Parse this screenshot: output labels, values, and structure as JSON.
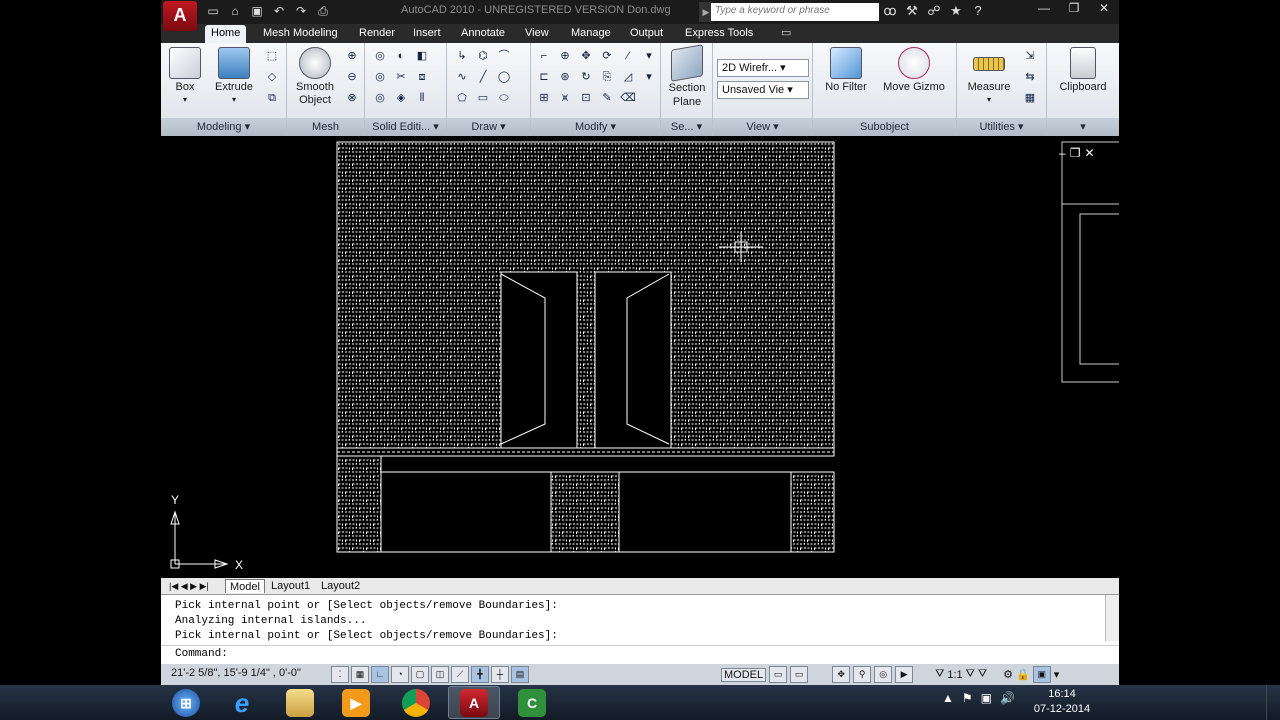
{
  "app": {
    "title": "AutoCAD 2010 - UNREGISTERED VERSION     Don.dwg",
    "search_placeholder": "Type a keyword or phrase",
    "logo_letter": "A"
  },
  "qat": [
    "new-icon",
    "open-icon",
    "save-icon",
    "undo-icon",
    "redo-icon",
    "plot-icon"
  ],
  "tabs": [
    "Home",
    "Mesh Modeling",
    "Render",
    "Insert",
    "Annotate",
    "View",
    "Manage",
    "Output",
    "Express Tools"
  ],
  "ribbon": {
    "modeling": {
      "title": "Modeling",
      "box": "Box",
      "extrude": "Extrude",
      "smooth": "Smooth Object"
    },
    "mesh": {
      "title": "Mesh"
    },
    "solid": {
      "title": "Solid Editi..."
    },
    "draw": {
      "title": "Draw"
    },
    "modify": {
      "title": "Modify"
    },
    "section": {
      "title": "Se...",
      "label": "Section Plane"
    },
    "view": {
      "title": "View",
      "visual_style": "2D Wirefr...",
      "saved_view": "Unsaved Vie"
    },
    "subobject": {
      "title": "Subobject",
      "no_filter": "No Filter",
      "move_gizmo": "Move Gizmo"
    },
    "utilities": {
      "title": "Utilities",
      "measure": "Measure"
    },
    "clipboard": {
      "label": "Clipboard"
    }
  },
  "ucs": {
    "x": "X",
    "y": "Y"
  },
  "layout_tabs": [
    "Model",
    "Layout1",
    "Layout2"
  ],
  "command": {
    "history": [
      "Pick internal point or [Select objects/remove Boundaries]:",
      "Analyzing internal islands...",
      "Pick internal point or [Select objects/remove Boundaries]:"
    ],
    "prompt": "Command:"
  },
  "status": {
    "coords": "21'-2 5/8\",  15'-9 1/4\" , 0'-0\"",
    "model_label": "MODEL",
    "scale": "1:1"
  },
  "taskbar": {
    "time": "16:14",
    "date": "07-12-2014"
  },
  "colors": {
    "brick_line": "#ffffff",
    "canvas": "#000000",
    "accent": "#c01820"
  }
}
